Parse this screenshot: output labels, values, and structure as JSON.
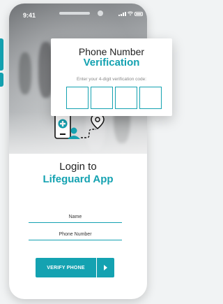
{
  "status": {
    "time": "9:41"
  },
  "verification": {
    "title": "Phone Number",
    "title_emphasis": "Verification",
    "hint": "Enter your 4-digit verification code:",
    "code_digits": [
      "",
      "",
      "",
      ""
    ]
  },
  "login": {
    "title": "Login to",
    "app_name": "Lifeguard App",
    "name_placeholder": "Name",
    "phone_placeholder": "Phone Number",
    "verify_button": "VERIFY PHONE"
  },
  "colors": {
    "accent": "#14a2b1",
    "text": "#222222",
    "background": "#f1f3f4"
  },
  "icons": {
    "illustration": "phone-with-medical-cross-and-person-and-location-pin"
  }
}
